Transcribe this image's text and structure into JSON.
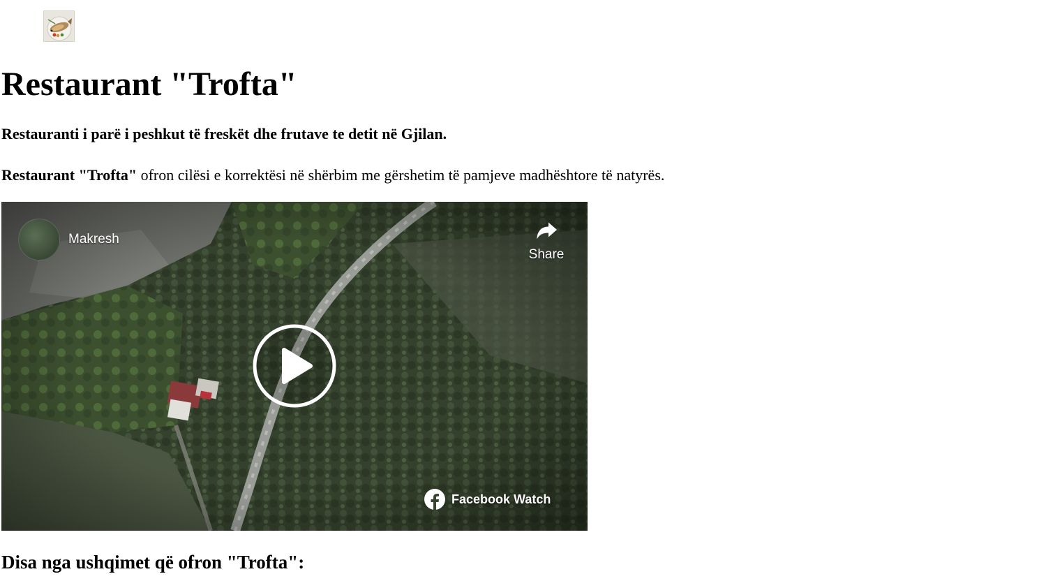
{
  "header": {
    "logo_icon": "fish-plate-icon"
  },
  "page": {
    "title": "Restaurant \"Trofta\"",
    "tagline": "Restauranti i parë i peshkut të freskët dhe frutave te detit në Gjilan.",
    "intro_bold": "Restaurant \"Trofta\"",
    "intro_rest": " ofron cilësi e korrektësi në shërbim me gërshetim të pamjeve madhështore të natyrës.",
    "menu_heading": "Disa nga ushqimet që ofron \"Trofta\":"
  },
  "video": {
    "channel_name": "Makresh",
    "share_label": "Share",
    "watch_label": "Facebook Watch",
    "play_icon": "play-icon",
    "share_icon": "share-arrow-icon",
    "facebook_icon": "facebook-logo-icon"
  }
}
